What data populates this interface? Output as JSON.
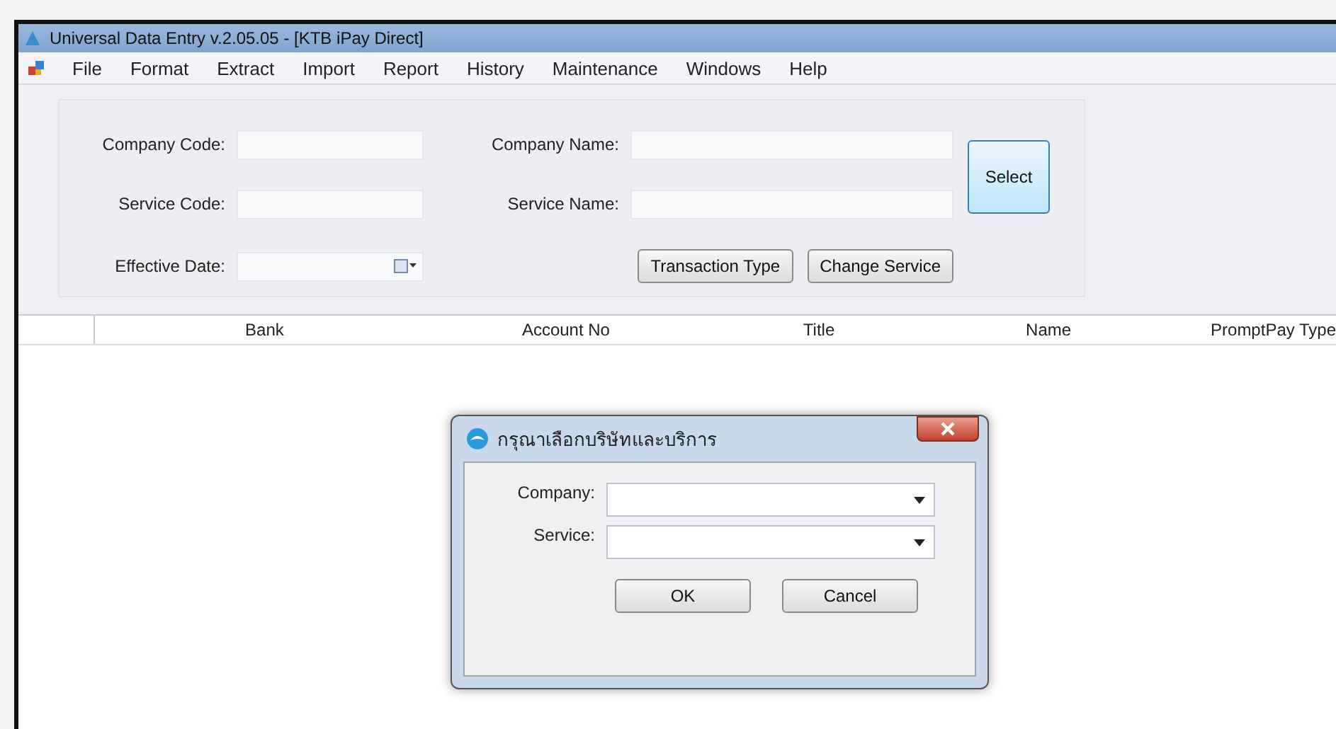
{
  "window": {
    "title": "Universal Data Entry v.2.05.05 - [KTB iPay Direct]"
  },
  "menu": [
    "File",
    "Format",
    "Extract",
    "Import",
    "Report",
    "History",
    "Maintenance",
    "Windows",
    "Help"
  ],
  "form": {
    "company_code_label": "Company Code:",
    "service_code_label": "Service Code:",
    "effective_date_label": "Effective Date:",
    "company_name_label": "Company Name:",
    "service_name_label": "Service Name:",
    "select_button": "Select",
    "transaction_type_button": "Transaction Type",
    "change_service_button": "Change Service"
  },
  "table": {
    "columns": [
      "Bank",
      "Account No",
      "Title",
      "Name",
      "PromptPay Type"
    ]
  },
  "dialog": {
    "title": "กรุณาเลือกบริษัทและบริการ",
    "company_label": "Company:",
    "service_label": "Service:",
    "ok_button": "OK",
    "cancel_button": "Cancel"
  }
}
